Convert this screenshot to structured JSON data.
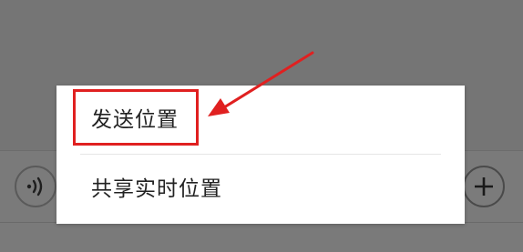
{
  "popup_menu": {
    "items": [
      {
        "label": "发送位置"
      },
      {
        "label": "共享实时位置"
      }
    ]
  },
  "input_bar": {
    "voice_icon": "voice-wave-icon",
    "plus_icon": "plus-icon"
  },
  "annotation": {
    "color": "#e02020"
  }
}
